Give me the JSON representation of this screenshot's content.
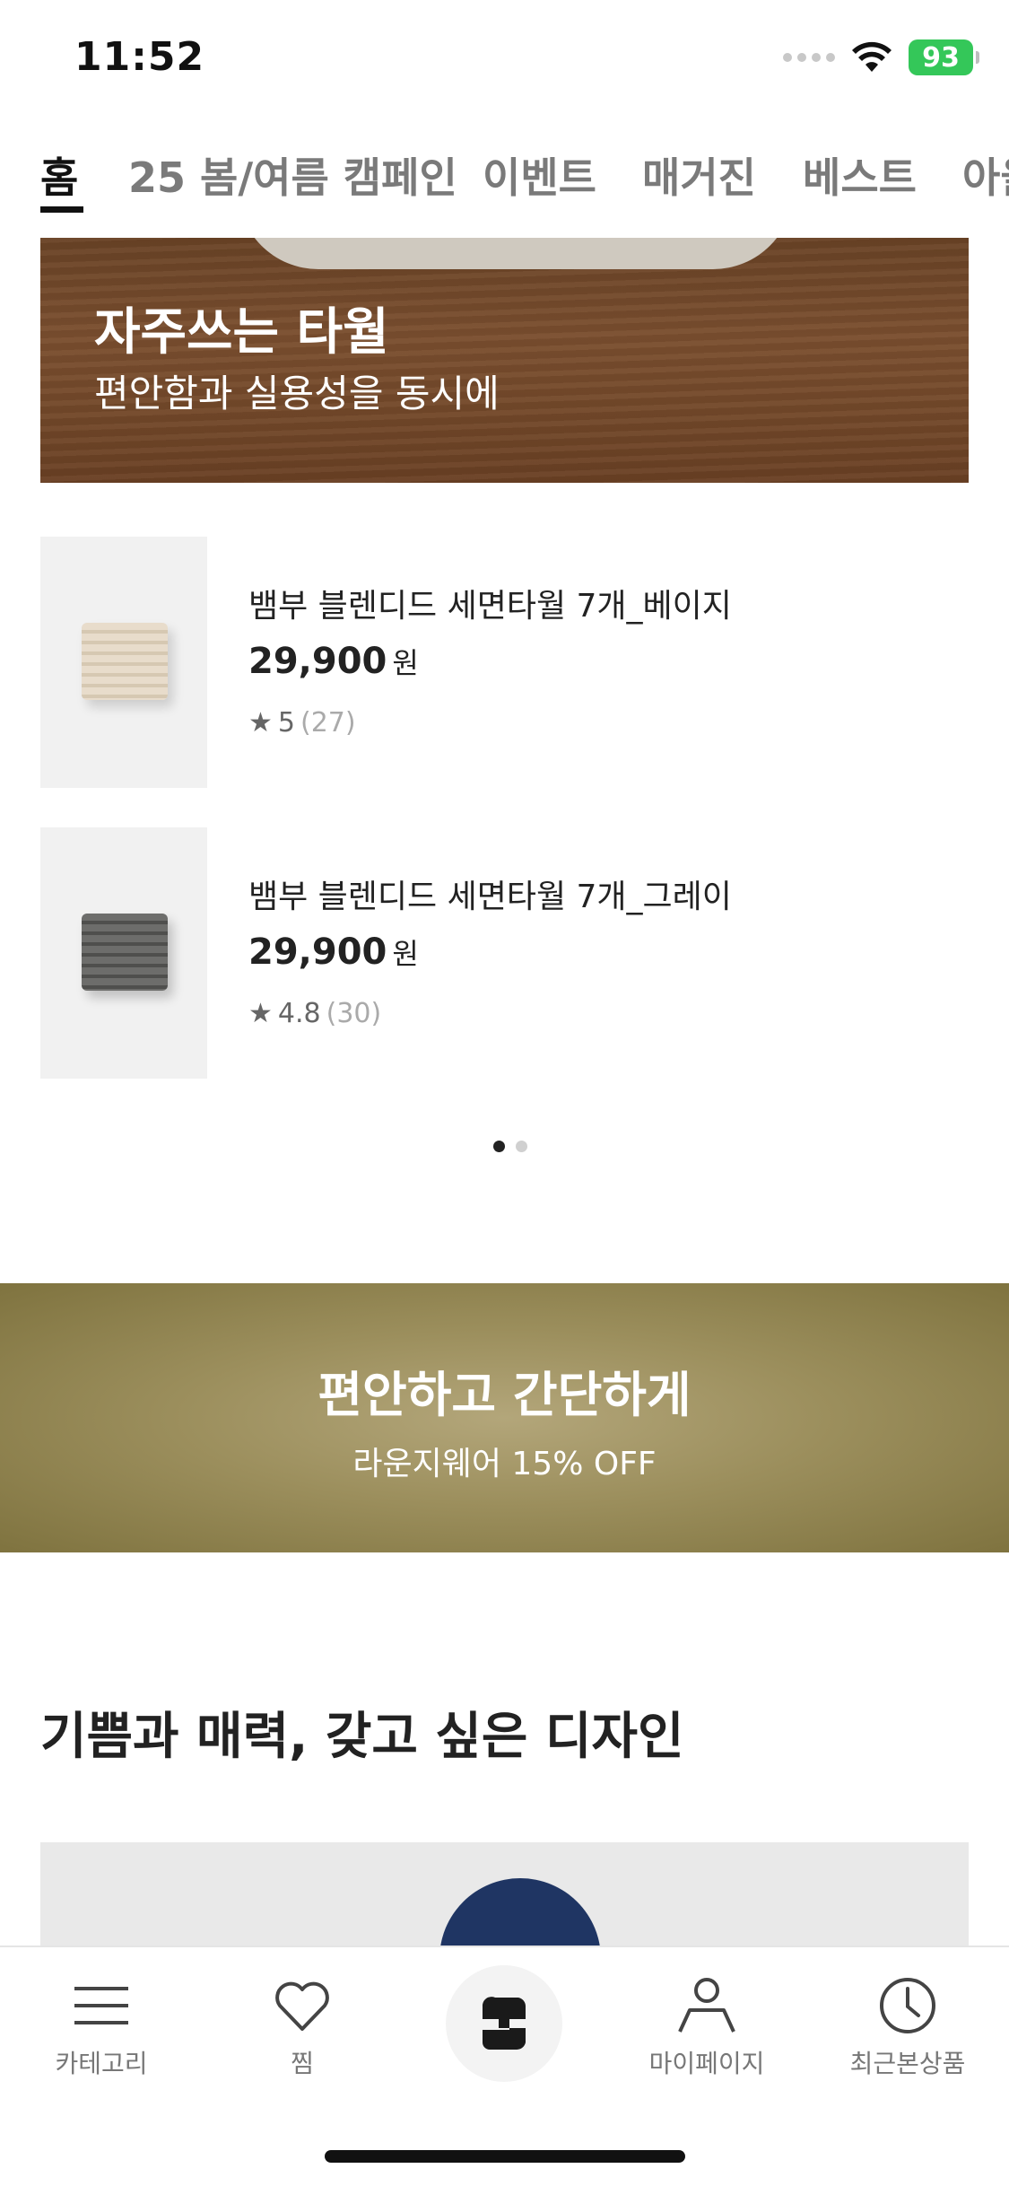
{
  "status_bar": {
    "time": "11:52",
    "battery": "93"
  },
  "top_tabs": [
    {
      "label": "홈",
      "active": true
    },
    {
      "label": "25 봄/여름 캠페인",
      "active": false
    },
    {
      "label": "이벤트",
      "active": false
    },
    {
      "label": "매거진",
      "active": false
    },
    {
      "label": "베스트",
      "active": false
    },
    {
      "label": "아울",
      "active": false
    }
  ],
  "hero": {
    "title": "자주쓰는 타월",
    "subtitle": "편안함과 실용성을 동시에"
  },
  "products": [
    {
      "name": "뱀부 블렌디드 세면타월 7개_베이지",
      "price": "29,900",
      "currency": "원",
      "rating": "5",
      "reviews": "(27)",
      "thumb_color": "beige"
    },
    {
      "name": "뱀부 블렌디드 세면타월 7개_그레이",
      "price": "29,900",
      "currency": "원",
      "rating": "4.8",
      "reviews": "(30)",
      "thumb_color": "gray"
    }
  ],
  "pager": {
    "current": 1,
    "total": 2
  },
  "promo": {
    "title": "편안하고 간단하게",
    "subtitle": "라운지웨어 15% OFF"
  },
  "section": {
    "title": "기쁨과 매력, 갖고 싶은 디자인"
  },
  "bottom_nav": {
    "items": [
      {
        "label": "카테고리",
        "icon": "menu-icon"
      },
      {
        "label": "찜",
        "icon": "heart-icon"
      },
      {
        "label": "",
        "icon": "brand-logo-icon"
      },
      {
        "label": "마이페이지",
        "icon": "person-icon"
      },
      {
        "label": "최근본상품",
        "icon": "clock-icon"
      }
    ]
  },
  "colors": {
    "accent": "#111111",
    "battery": "#34c759",
    "promo_bg": "#9c8f5d",
    "hero_bg": "#7b4f2f"
  }
}
